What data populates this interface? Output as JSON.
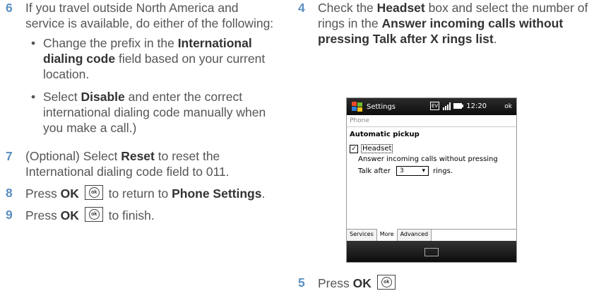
{
  "left": {
    "step6": {
      "num": "6",
      "text": "If you travel outside North America and service is available, do either of the following:",
      "bullet1": {
        "pre": "Change the prefix in the ",
        "bold": "International dialing code",
        "post": " field based on your current location."
      },
      "bullet2": {
        "pre": "Select ",
        "bold": "Disable",
        "post": " and enter the correct international dialing code manually when you make a call.)"
      }
    },
    "step7": {
      "num": "7",
      "pre": "(Optional) Select ",
      "bold": "Reset",
      "post": " to reset the International dialing code field to 011."
    },
    "step8": {
      "num": "8",
      "pre": "Press ",
      "bold1": "OK",
      "mid": " to return to ",
      "bold2": "Phone Settings",
      "post": "."
    },
    "step9": {
      "num": "9",
      "pre": "Press ",
      "bold": "OK",
      "post": " to finish."
    }
  },
  "right": {
    "step4": {
      "num": "4",
      "pre": "Check the ",
      "bold1": "Headset",
      "mid": " box and select the number of rings in the ",
      "bold2": "Answer incoming calls without pressing Talk after X rings list",
      "post": "."
    },
    "step5": {
      "num": "5",
      "pre": "Press ",
      "bold": "OK"
    }
  },
  "ok_key_glyph": "ok",
  "device": {
    "title": "Settings",
    "status_box": "EV",
    "time": "12:20",
    "ok": "ok",
    "page_label": "Phone",
    "section_title": "Automatic pickup",
    "headset_label": "Headset",
    "headset_checked": true,
    "check_glyph": "✓",
    "answer_text": "Answer incoming calls without pressing",
    "talk_after_label": "Talk after",
    "rings_value": "3",
    "rings_label": "rings.",
    "tabs": [
      "Services",
      "More",
      "Advanced"
    ],
    "active_tab": "More"
  },
  "colors": {
    "step_number": "#5b8fc1",
    "body_text": "#555555",
    "bold_text": "#333333"
  }
}
